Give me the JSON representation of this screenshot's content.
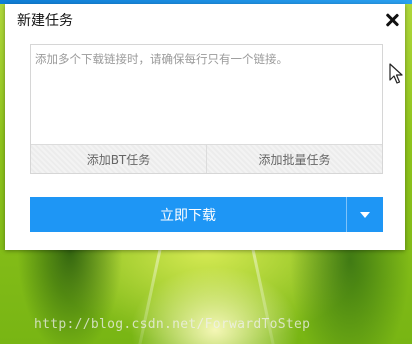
{
  "dialog": {
    "title": "新建任务",
    "close_icon": "close-icon"
  },
  "link_input": {
    "value": "",
    "placeholder": "添加多个下载链接时，请确保每行只有一个链接。"
  },
  "actions": {
    "add_bt_label": "添加BT任务",
    "add_batch_label": "添加批量任务"
  },
  "download": {
    "label": "立即下载",
    "dropdown_icon": "chevron-down-icon"
  },
  "watermark": "http://blog.csdn.net/ForwardToStep",
  "colors": {
    "accent": "#1e96f5",
    "top_bar": "#1a8ee6",
    "dialog_bg": "#ffffff"
  }
}
